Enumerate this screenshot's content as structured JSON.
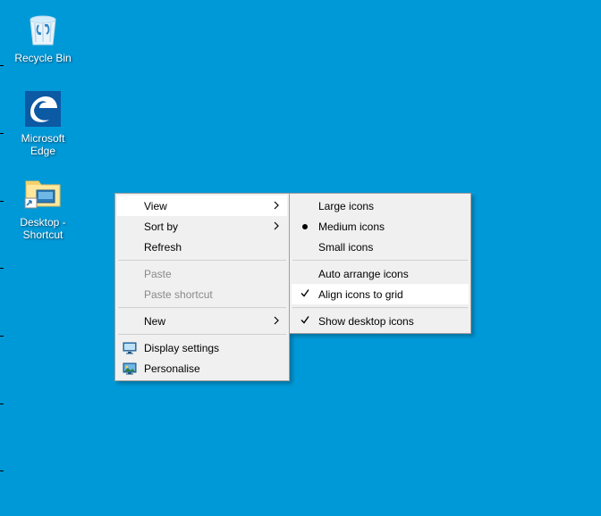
{
  "desktop": {
    "icons": [
      {
        "label": "Recycle Bin"
      },
      {
        "label": "Microsoft Edge"
      },
      {
        "label": "Desktop - Shortcut"
      }
    ]
  },
  "contextMenu": {
    "items": {
      "view": "View",
      "sortBy": "Sort by",
      "refresh": "Refresh",
      "paste": "Paste",
      "pasteShortcut": "Paste shortcut",
      "new": "New",
      "displaySettings": "Display settings",
      "personalise": "Personalise"
    }
  },
  "viewSubmenu": {
    "items": {
      "largeIcons": "Large icons",
      "mediumIcons": "Medium icons",
      "smallIcons": "Small icons",
      "autoArrange": "Auto arrange icons",
      "alignToGrid": "Align icons to grid",
      "showDesktopIcons": "Show desktop icons"
    }
  }
}
